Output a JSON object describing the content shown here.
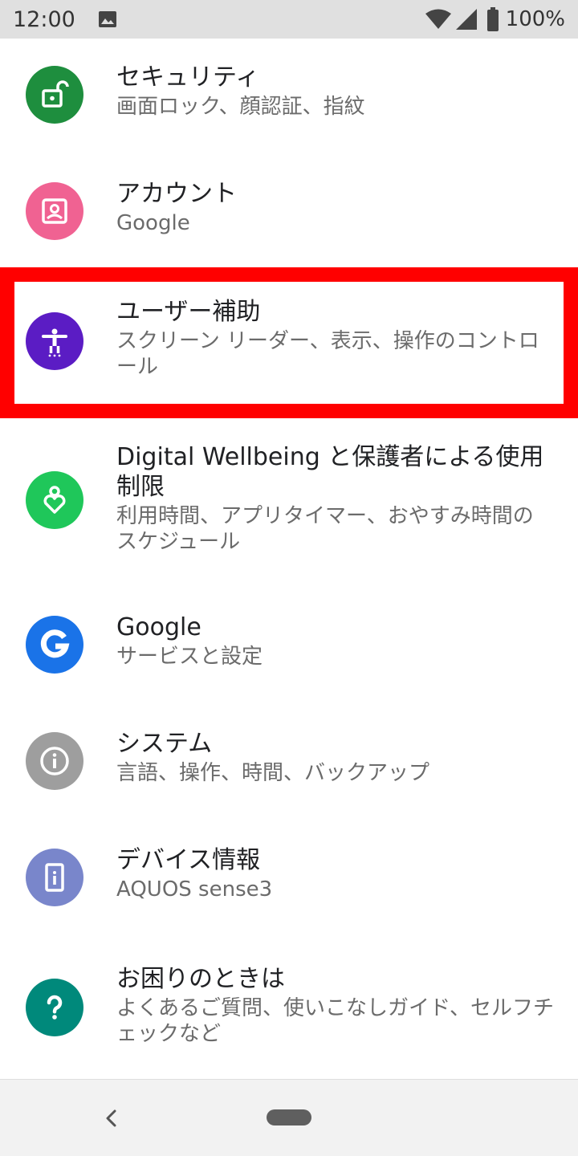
{
  "status_bar": {
    "time": "12:00",
    "battery": "100%",
    "icons": [
      "gallery-icon",
      "wifi-icon",
      "signal-icon",
      "battery-icon"
    ]
  },
  "settings": {
    "items": [
      {
        "title": "セキュリティ",
        "subtitle": "画面ロック、顔認証、指紋",
        "icon": "unlock-icon",
        "color": "#1e8e3e"
      },
      {
        "title": "アカウント",
        "subtitle": "Google",
        "icon": "account-icon",
        "color": "#f06292"
      },
      {
        "title": "ユーザー補助",
        "subtitle": "スクリーン リーダー、表示、操作のコントロール",
        "icon": "accessibility-icon",
        "color": "#5b1cc4"
      },
      {
        "title": "Digital Wellbeing と保護者による使用制限",
        "subtitle": "利用時間、アプリタイマー、おやすみ時間のスケジュール",
        "icon": "wellbeing-heart-icon",
        "color": "#1fc75a"
      },
      {
        "title": "Google",
        "subtitle": "サービスと設定",
        "icon": "google-g-icon",
        "color": "#1a73e8"
      },
      {
        "title": "システム",
        "subtitle": "言語、操作、時間、バックアップ",
        "icon": "info-icon",
        "color": "#9e9e9e"
      },
      {
        "title": "デバイス情報",
        "subtitle": "AQUOS sense3",
        "icon": "phone-icon",
        "color": "#7986cb"
      },
      {
        "title": "お困りのときは",
        "subtitle": "よくあるご質問、使いこなしガイド、セルフチェックなど",
        "icon": "help-icon",
        "color": "#00897b"
      }
    ]
  },
  "highlight_color": "#ff0000",
  "nav_bar": {
    "icons": [
      "back-icon",
      "home-pill-icon"
    ]
  }
}
